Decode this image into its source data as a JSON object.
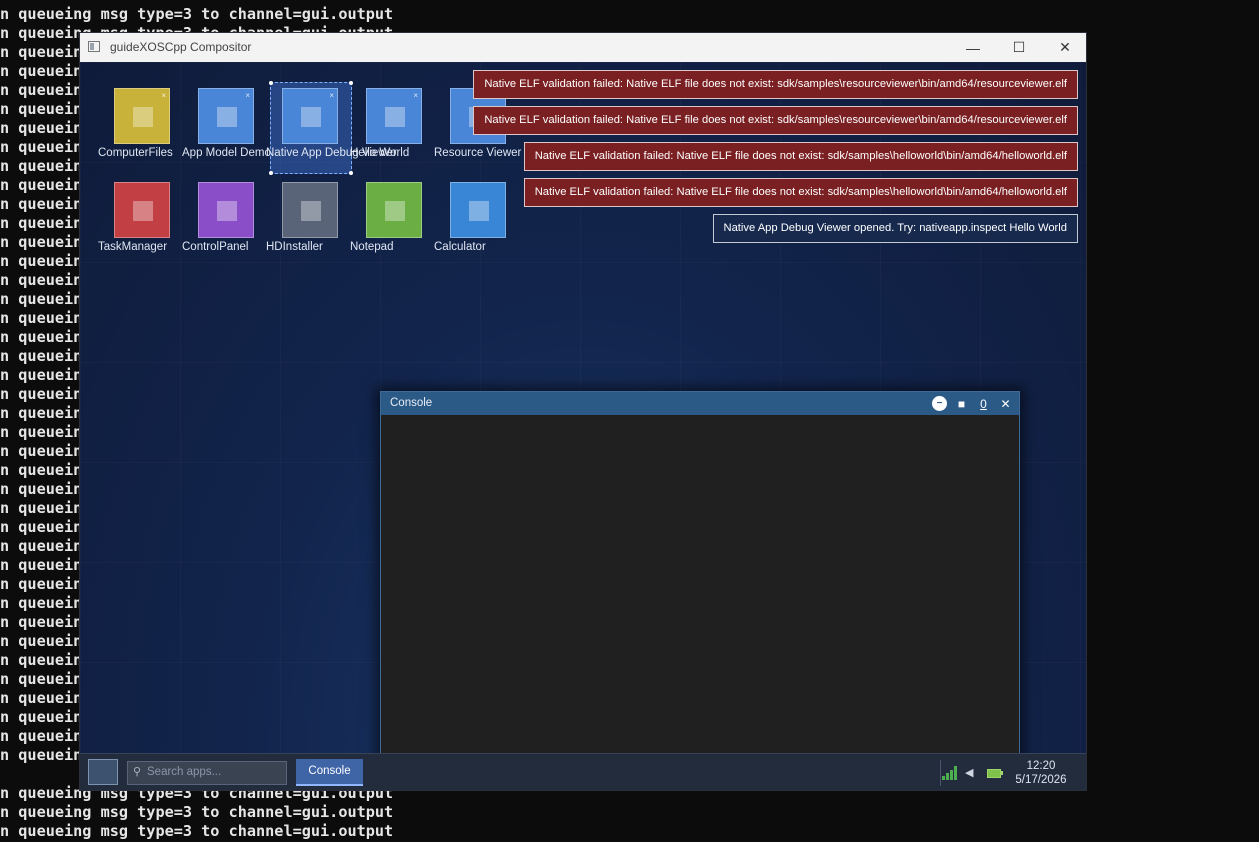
{
  "terminal": {
    "top_lines": [
      "n queueing msg type=3 to channel=gui.output",
      "n queueing msg type=3 to channel=gui.output"
    ],
    "side_line": "n queueing",
    "bottom_lines": [
      "n queueing msg type=3 to channel=gui.output",
      "n queueing msg type=3 to channel=gui.output",
      "n queueing msg type=3 to channel=gui.output"
    ]
  },
  "host_window": {
    "title": "guideXOSCpp Compositor",
    "minimize_glyph": "—",
    "maximize_glyph": "☐",
    "close_glyph": "✕"
  },
  "desktop": {
    "icons": [
      {
        "label": "ComputerFiles",
        "color": "#c8b23a",
        "pinned": true
      },
      {
        "label": "App Model Demo",
        "color": "#4a86d8",
        "pinned": true
      },
      {
        "label": "Native App Debug Viewer",
        "color": "#4a86d8",
        "pinned": true,
        "selected": true
      },
      {
        "label": "Hello World",
        "color": "#4a86d8",
        "pinned": true
      },
      {
        "label": "Resource Viewer Future",
        "color": "#4a86d8",
        "pinned": false
      },
      {
        "label": "TaskManager",
        "color": "#c23f43",
        "pinned": false
      },
      {
        "label": "ControlPanel",
        "color": "#8a4fc8",
        "pinned": false
      },
      {
        "label": "HDInstaller",
        "color": "#5a6478",
        "pinned": false
      },
      {
        "label": "Notepad",
        "color": "#6aae44",
        "pinned": false
      },
      {
        "label": "Calculator",
        "color": "#3a86d6",
        "pinned": false
      }
    ],
    "pin_glyph": "×"
  },
  "notifications": [
    {
      "text": "Native ELF validation failed: Native ELF file does not exist: sdk/samples\\resourceviewer\\bin/amd64/resourceviewer.elf",
      "kind": "err"
    },
    {
      "text": "Native ELF validation failed: Native ELF file does not exist: sdk/samples\\resourceviewer\\bin/amd64/resourceviewer.elf",
      "kind": "err"
    },
    {
      "text": "Native ELF validation failed: Native ELF file does not exist: sdk/samples\\helloworld\\bin/amd64/helloworld.elf",
      "kind": "err"
    },
    {
      "text": "Native ELF validation failed: Native ELF file does not exist: sdk/samples\\helloworld\\bin/amd64/helloworld.elf",
      "kind": "err"
    },
    {
      "text": "Native App Debug Viewer opened. Try: nativeapp.inspect Hello World",
      "kind": "info"
    }
  ],
  "console_window": {
    "title": "Console",
    "minimize_glyph": "−",
    "maximize_glyph": "■",
    "info_glyph": "0",
    "close_glyph": "✕"
  },
  "taskbar": {
    "search_placeholder": "Search apps...",
    "search_glyph": "⚲",
    "active_task": "Console",
    "volume_glyph": "◀",
    "clock_time": "12:20",
    "clock_date": "5/17/2026"
  }
}
